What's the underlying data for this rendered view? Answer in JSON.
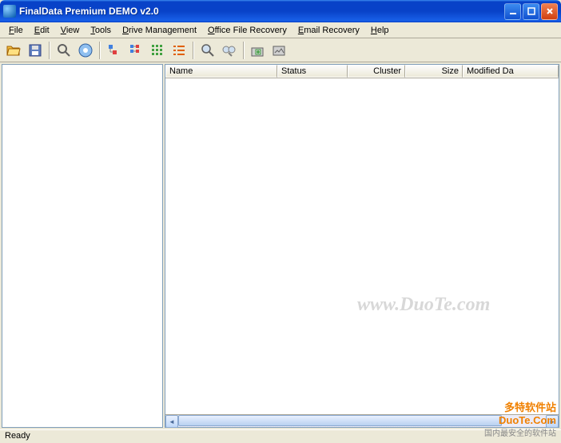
{
  "title": "FinalData Premium DEMO v2.0",
  "menus": {
    "file": "File",
    "edit": "Edit",
    "view": "View",
    "tools": "Tools",
    "drive": "Drive Management",
    "office": "Office File Recovery",
    "email": "Email Recovery",
    "help": "Help"
  },
  "columns": {
    "name": "Name",
    "status": "Status",
    "cluster": "Cluster",
    "size": "Size",
    "modified": "Modified Da"
  },
  "status_text": "Ready",
  "watermark": "www.DuoTe.com",
  "badge": {
    "brand": "多特软件站",
    "domain": "DuoTe.Com",
    "tagline": "国内最安全的软件站"
  },
  "toolbar_icons": [
    "open-icon",
    "save-icon",
    "search-icon",
    "scan-icon",
    "tree-collapse-icon",
    "tree-expand-icon",
    "list-small-icon",
    "list-detail-icon",
    "find-icon",
    "find-next-icon",
    "recover-icon",
    "preview-icon"
  ],
  "colors": {
    "titlebar_blue": "#0842c8",
    "close_red": "#d04010",
    "chrome_bg": "#ece9d8"
  }
}
